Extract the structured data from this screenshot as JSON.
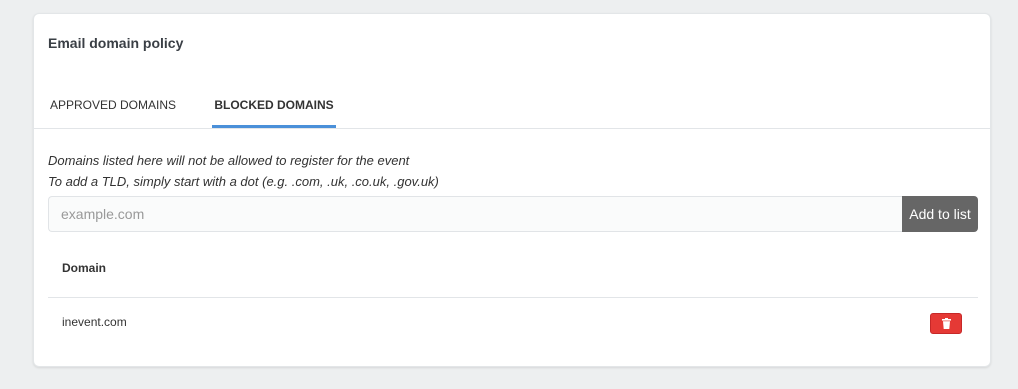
{
  "card": {
    "title": "Email domain policy"
  },
  "tabs": [
    {
      "label": "APPROVED DOMAINS",
      "active": false
    },
    {
      "label": "BLOCKED DOMAINS",
      "active": true
    }
  ],
  "description": {
    "line1": "Domains listed here will not be allowed to register for the event",
    "line2": "To add a TLD, simply start with a dot (e.g. .com, .uk, .co.uk, .gov.uk)"
  },
  "domain_input": {
    "value": "",
    "placeholder": "example.com"
  },
  "add_button": {
    "label": "Add to list"
  },
  "table": {
    "header": "Domain",
    "rows": [
      {
        "domain": "inevent.com",
        "action_icon": "trash-icon"
      }
    ]
  },
  "colors": {
    "active_tab_underline": "#4a90d9",
    "add_button_bg": "#666666",
    "delete_button_bg": "#e53935"
  }
}
